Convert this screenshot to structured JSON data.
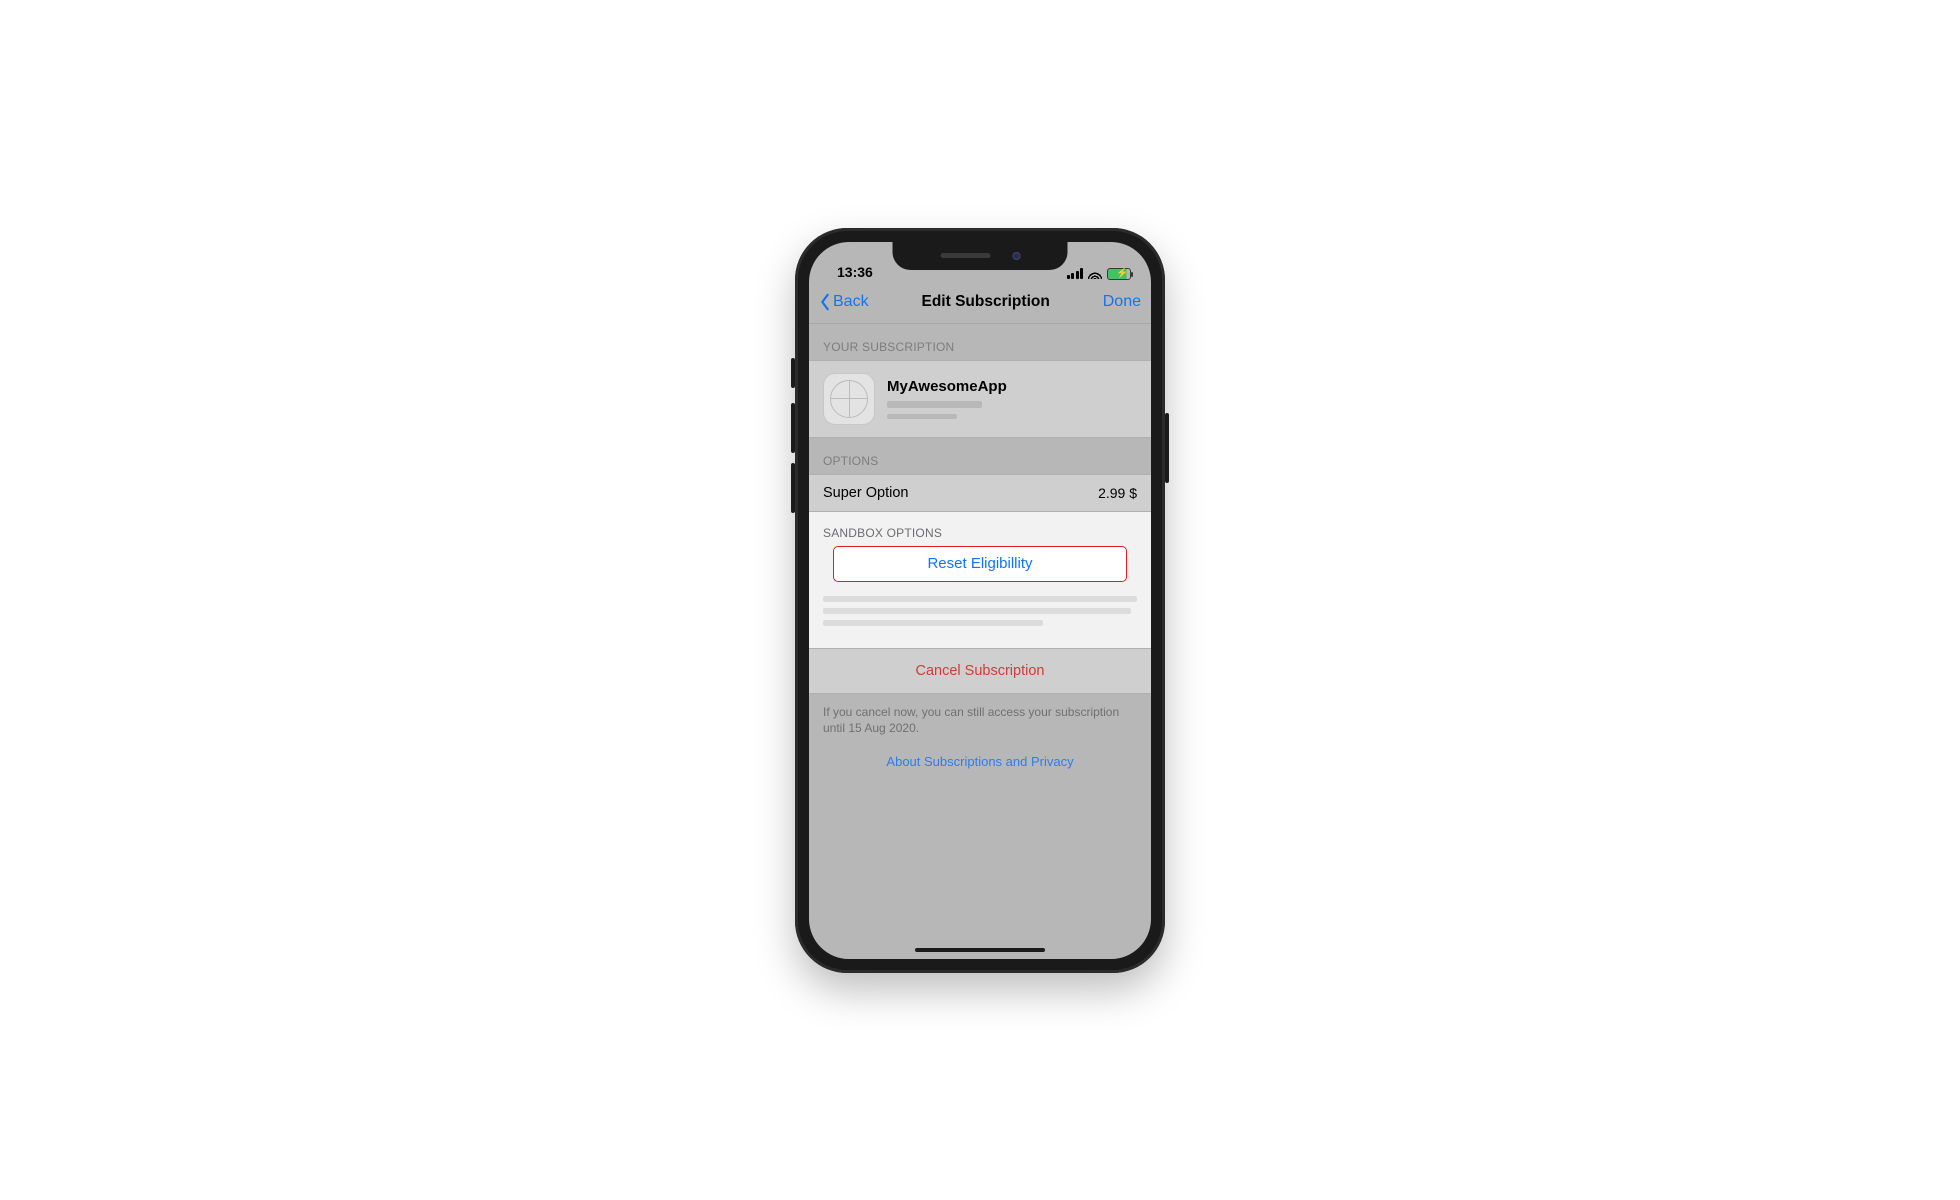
{
  "statusbar": {
    "time": "13:36"
  },
  "nav": {
    "back": "Back",
    "title": "Edit Subscription",
    "done": "Done"
  },
  "subscription": {
    "section_label": "YOUR SUBSCRIPTION",
    "app_name": "MyAwesomeApp"
  },
  "options": {
    "section_label": "OPTIONS",
    "items": [
      {
        "name": "Super Option",
        "price": "2.99 $"
      }
    ]
  },
  "sandbox": {
    "section_label": "SANDBOX OPTIONS",
    "reset_label": "Reset Eligibillity"
  },
  "cancel": {
    "label": "Cancel Subscription"
  },
  "footer": {
    "note": "If you cancel now, you can still access your subscription until 15 Aug 2020."
  },
  "about": {
    "label": "About Subscriptions and Privacy"
  },
  "colors": {
    "ios_blue": "#0a75ff",
    "danger_red": "#d93a33",
    "highlight_border": "#e02020"
  }
}
